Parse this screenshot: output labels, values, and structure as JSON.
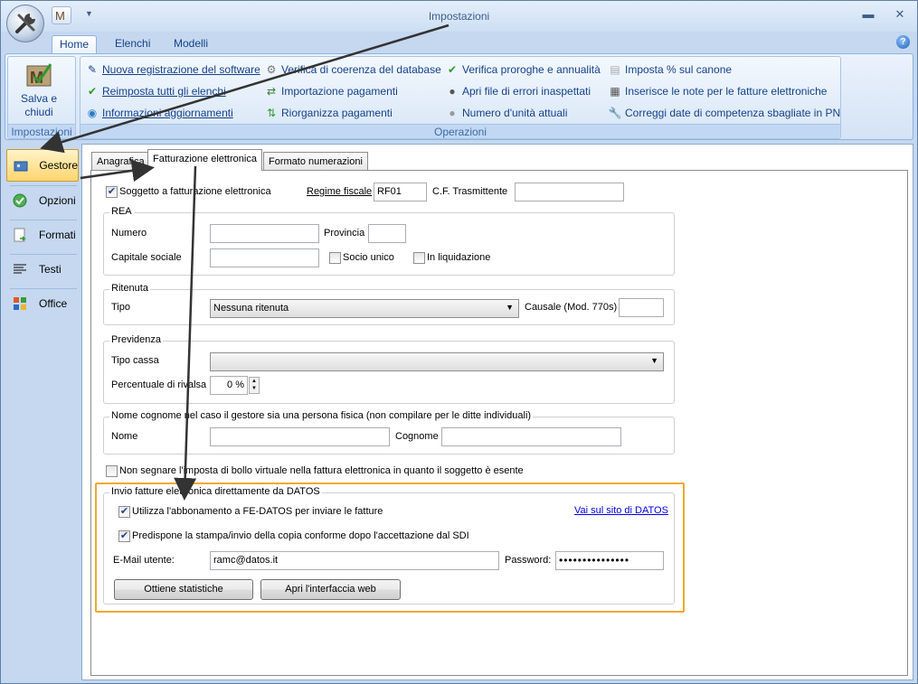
{
  "window": {
    "title": "Impostazioni"
  },
  "ribbon_tabs": [
    "Home",
    "Elenchi",
    "Modelli"
  ],
  "groups": {
    "impostazioni": {
      "label": "Impostazioni",
      "save_label_1": "Salva e",
      "save_label_2": "chiudi"
    },
    "operazioni": {
      "label": "Operazioni",
      "buttons": [
        "Nuova registrazione del software",
        "Reimposta tutti gli elenchi",
        "Informazioni aggiornamenti",
        "Verifica di coerenza del database",
        "Importazione pagamenti",
        "Riorganizza pagamenti",
        "Verifica proroghe e annualità",
        "Apri file di errori inaspettati",
        "Numero d'unità attuali",
        "Imposta  % sul canone",
        "Inserisce le note per le fatture elettroniche",
        "Correggi date di competenza sbagliate in PN"
      ]
    }
  },
  "nav": [
    "Gestore",
    "Opzioni",
    "Formati",
    "Testi",
    "Office"
  ],
  "content_tabs": [
    "Anagrafica",
    "Fatturazione elettronica",
    "Formato numerazioni"
  ],
  "form": {
    "soggetto_label": "Soggetto a fatturazione elettronica",
    "soggetto_checked": true,
    "regime_label": "Regime fiscale",
    "regime_value": "RF01",
    "cf_label": "C.F. Trasmittente",
    "cf_value": "",
    "rea": {
      "legend": "REA",
      "numero_label": "Numero",
      "provincia_label": "Provincia",
      "capitale_label": "Capitale sociale",
      "socio_unico_label": "Socio unico",
      "liquidazione_label": "In liquidazione"
    },
    "ritenuta": {
      "legend": "Ritenuta",
      "tipo_label": "Tipo",
      "tipo_value": "Nessuna ritenuta",
      "causale_label": "Causale (Mod. 770s)"
    },
    "previdenza": {
      "legend": "Previdenza",
      "tipo_cassa_label": "Tipo cassa",
      "percentuale_label": "Percentuale di rivalsa",
      "percentuale_value": "0 %"
    },
    "persona": {
      "legend": "Nome cognome nel caso il gestore sia una persona fisica (non compilare per le ditte individuali)",
      "nome_label": "Nome",
      "cognome_label": "Cognome"
    },
    "bollo_label": "Non segnare l'imposta di bollo virtuale nella fattura elettronica in quanto il soggetto è esente",
    "invio": {
      "legend": "Invio fatture elettronica direttamente da DATOS",
      "abbonamento_label": "Utilizza l'abbonamento a FE-DATOS per inviare le fatture",
      "predispone_label": "Predispone la stampa/invio della copia conforme dopo l'accettazione dal SDI",
      "link": "Vai sul sito di DATOS",
      "email_label": "E-Mail utente:",
      "email_value": "ramc@datos.it",
      "password_label": "Password:",
      "password_value": "•••••••••••••••",
      "btn_statistiche": "Ottiene statistiche",
      "btn_web": "Apri l'interfaccia web"
    }
  },
  "colors": {
    "accent": "#15428b",
    "highlight": "#f0a830",
    "nav_active": "#ffd56e"
  }
}
